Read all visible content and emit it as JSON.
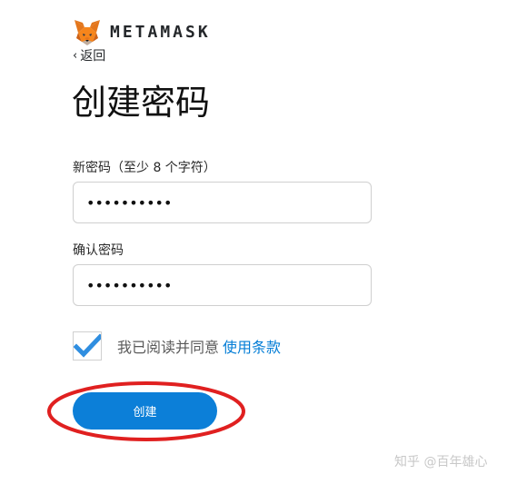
{
  "header": {
    "brand": "METAMASK",
    "back_label": "返回",
    "logo_icon": "metamask-fox-icon"
  },
  "page": {
    "title": "创建密码"
  },
  "form": {
    "new_password_label": "新密码（至少 8 个字符）",
    "new_password_value": "••••••••••",
    "confirm_password_label": "确认密码",
    "confirm_password_value": "••••••••••",
    "terms_checked": true,
    "terms_text": "我已阅读并同意",
    "terms_link_label": "使用条款",
    "create_button_label": "创建"
  },
  "colors": {
    "accent": "#037dd6",
    "button": "#0c7fd8",
    "checkmark": "#2f8ee0",
    "annotation": "#e02020"
  },
  "watermark": "知乎 @百年雄心"
}
